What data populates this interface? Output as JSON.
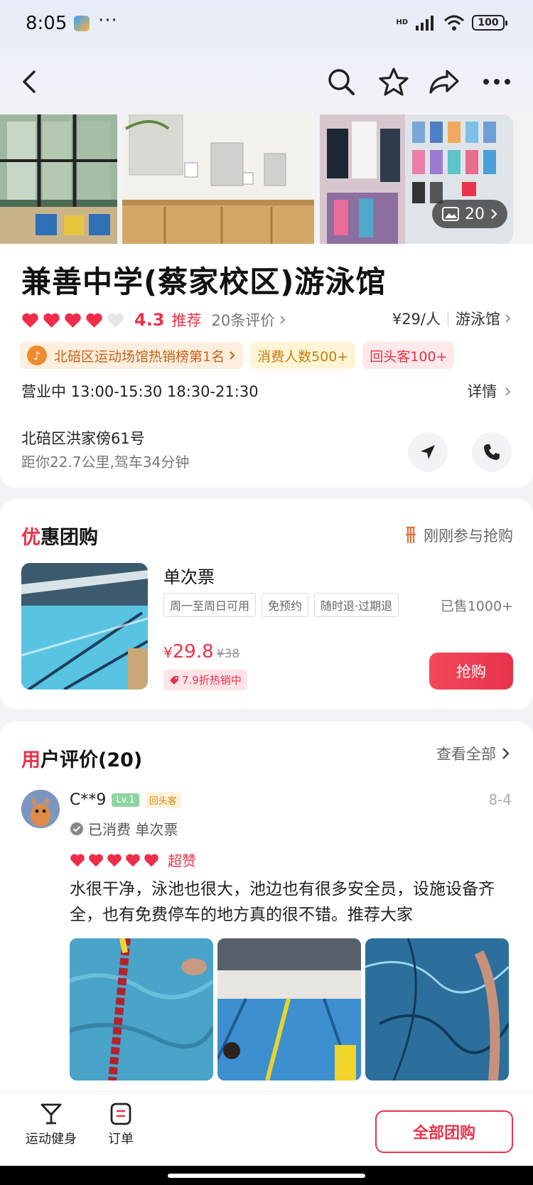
{
  "status_bar": {
    "time": "8:05",
    "dots": "···",
    "network": "HD",
    "battery": "100"
  },
  "nav": {
    "back_icon": "back-arrow-icon",
    "search_icon": "search-icon",
    "favorite_icon": "star-icon",
    "share_icon": "share-icon",
    "more_icon": "more-icon"
  },
  "gallery": {
    "photo_count": "20"
  },
  "shop": {
    "name": "兼善中学(蔡家校区)游泳馆",
    "rating": "4.3",
    "rating_label": "推荐",
    "review_count": "20条评价",
    "price": "¥29/人",
    "category": "游泳馆",
    "tags": [
      "北碚区运动场馆热销榜第1名",
      "消费人数500+",
      "回头客100+"
    ],
    "hours": "营业中 13:00-15:30 18:30-21:30",
    "hours_detail": "详情",
    "address": "北碚区洪家傍61号",
    "distance": "距你22.7公里,驾车34分钟"
  },
  "deals": {
    "title_first": "优",
    "title_rest": "惠团购",
    "recent": "刚刚参与抢购",
    "item": {
      "title": "单次票",
      "tags": [
        "周一至周日可用",
        "免预约",
        "随时退·过期退"
      ],
      "sold": "已售1000+",
      "price_symbol": "¥",
      "price": "29.8",
      "old_price": "¥38",
      "discount": "7.9折热销中",
      "buy_label": "抢购"
    }
  },
  "reviews": {
    "title_first": "用",
    "title_rest": "户评价(20)",
    "see_all": "查看全部",
    "item": {
      "user": "C**9",
      "level": "Lv.1",
      "badge": "回头客",
      "date": "8-4",
      "consumed": "已消费 单次票",
      "rating_label": "超赞",
      "text": "水很干净，泳池也很大，池边也有很多安全员，设施设备齐全，也有免费停车的地方真的很不错。推荐大家"
    }
  },
  "bottom_bar": {
    "sport_label": "运动健身",
    "order_label": "订单",
    "all_deals_label": "全部团购"
  },
  "colors": {
    "accent": "#e8334a",
    "tag_orange": "#c8621a",
    "tag_yellow": "#c67e0f"
  }
}
